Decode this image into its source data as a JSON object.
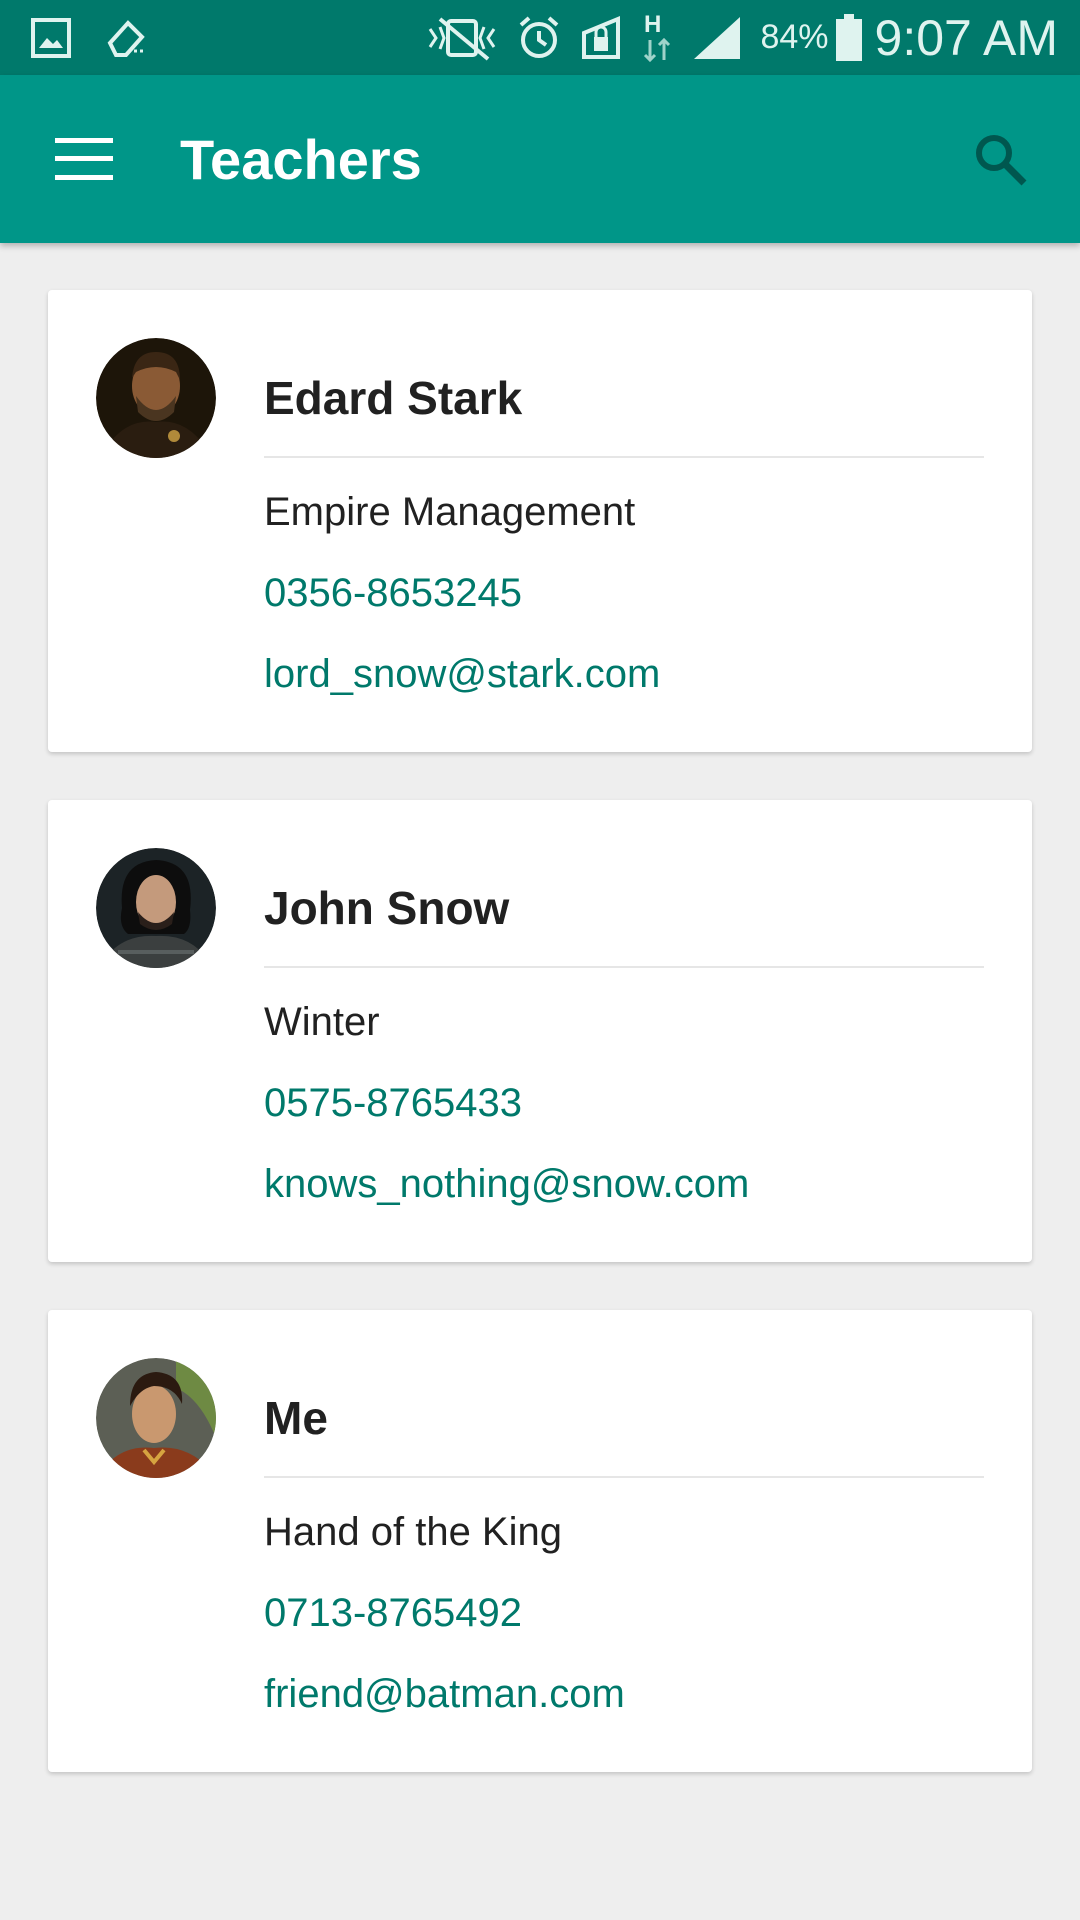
{
  "status_bar": {
    "battery_percent": "84%",
    "time": "9:07 AM",
    "icons": [
      "gallery-icon",
      "eraser-icon",
      "vibrate-icon",
      "alarm-icon",
      "lock-icon",
      "network-h-icon",
      "signal-icon",
      "battery-icon"
    ]
  },
  "app_bar": {
    "title": "Teachers",
    "background": "#009688",
    "status_background": "#00796b"
  },
  "teachers": [
    {
      "name": "Edard Stark",
      "department": "Empire Management",
      "phone": "0356-8653245",
      "email": "lord_snow@stark.com"
    },
    {
      "name": "John Snow",
      "department": "Winter",
      "phone": "0575-8765433",
      "email": "knows_nothing@snow.com"
    },
    {
      "name": "Me",
      "department": "Hand of the King",
      "phone": "0713-8765492",
      "email": "friend@batman.com"
    }
  ],
  "colors": {
    "accent": "#00796b",
    "background": "#eeeeee",
    "card": "#ffffff"
  }
}
